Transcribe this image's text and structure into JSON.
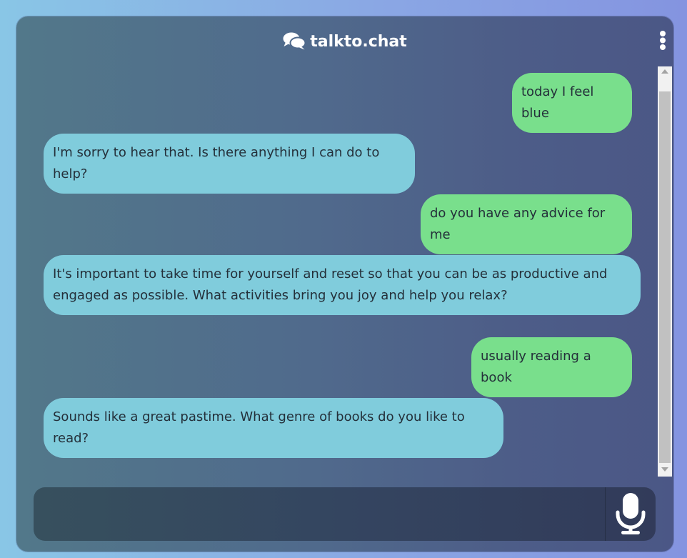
{
  "app": {
    "title": "talkto.chat",
    "icon": "chat-bubbles-icon",
    "menu_icon": "vertical-dots-icon"
  },
  "messages": [
    {
      "role": "user",
      "text": "today I feel blue"
    },
    {
      "role": "bot",
      "text": "I'm sorry to hear that. Is there anything I can do to help?"
    },
    {
      "role": "user",
      "text": "do you have any advice for me"
    },
    {
      "role": "bot",
      "text": "It's important to take time for yourself and reset so that you can be as productive and engaged as possible. What activities bring you joy and help you relax?"
    },
    {
      "role": "user",
      "text": "usually reading a book"
    },
    {
      "role": "bot",
      "text": "Sounds like a great pastime. What genre of books do you like to read?"
    }
  ],
  "composer": {
    "value": "",
    "placeholder": "",
    "mic_icon": "microphone-icon"
  },
  "colors": {
    "user_bubble": "#79df8c",
    "bot_bubble": "#80ccdc",
    "text": "#24303a"
  }
}
